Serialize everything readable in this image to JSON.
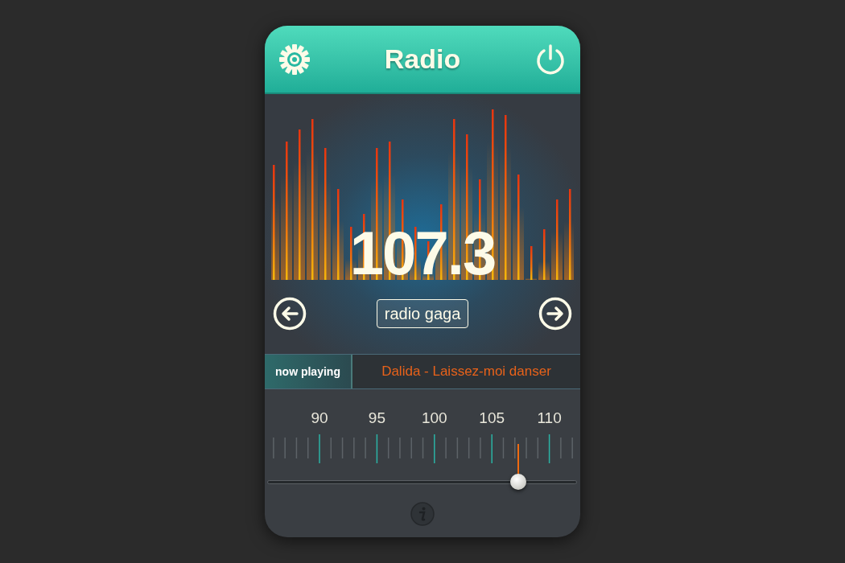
{
  "header": {
    "title": "Radio"
  },
  "station": {
    "frequency": "107.3",
    "name": "radio gaga"
  },
  "now_playing": {
    "label": "now playing",
    "track": "Dalida - Laissez-moi danser"
  },
  "tuner": {
    "scale_labels": [
      "90",
      "95",
      "100",
      "105",
      "110"
    ],
    "level": 0.81
  }
}
